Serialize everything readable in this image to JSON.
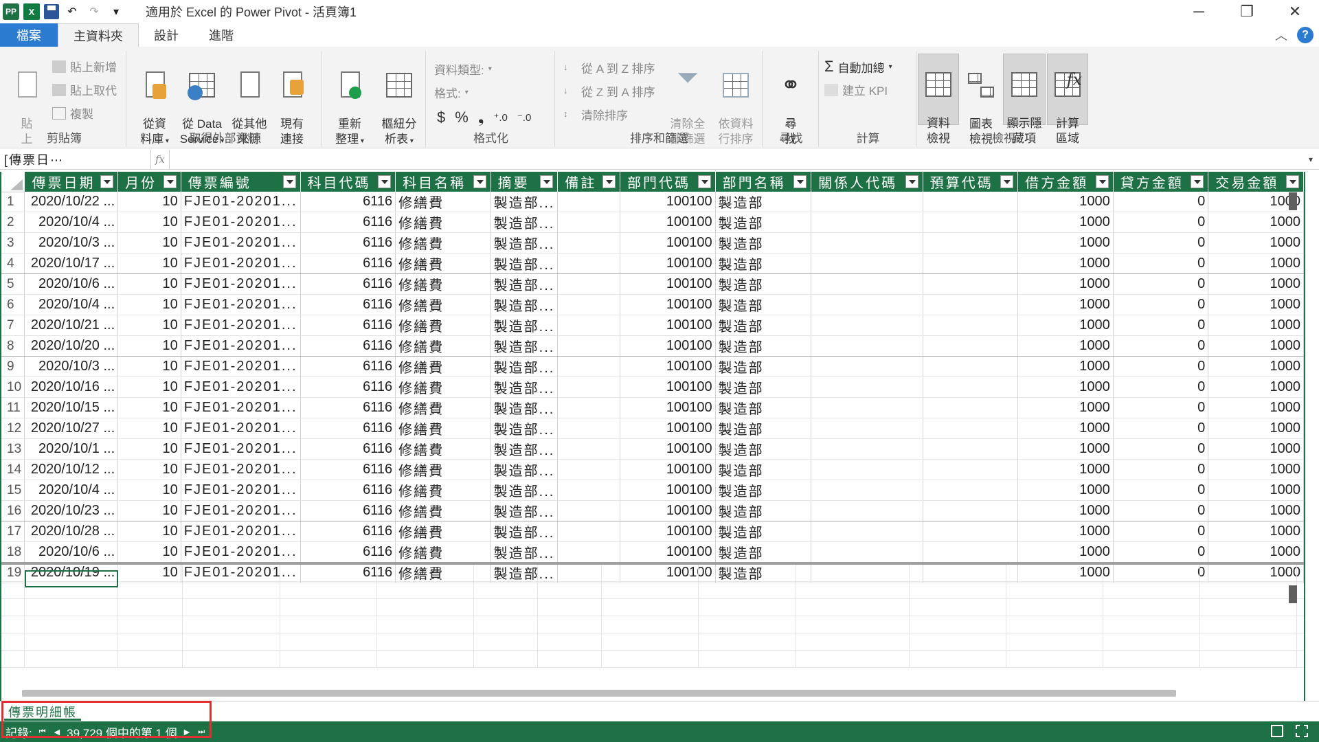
{
  "window": {
    "title": "適用於 Excel 的 Power Pivot - 活頁簿1",
    "minimize": "─",
    "restore": "❐",
    "close": "✕"
  },
  "qat": {
    "undo": "↶",
    "redo": "↷",
    "customize": "▾"
  },
  "tabs": [
    "檔案",
    "主資料夾",
    "設計",
    "進階"
  ],
  "ribbon": {
    "clipboard": {
      "label": "剪貼簿",
      "paste": "貼\n上",
      "paste_append": "貼上新增",
      "paste_replace": "貼上取代",
      "copy": "複製"
    },
    "external": {
      "label": "取得外部資料",
      "from_db": "從資\n料庫",
      "from_service": "從 Data\nService",
      "from_other": "從其他\n來源",
      "existing": "現有\n連接"
    },
    "refresh": "重新\n整理",
    "pivot": "樞紐分\n析表",
    "format": {
      "label": "格式化",
      "data_type": "資料類型:",
      "format": "格式:",
      "currency": "$",
      "percent": "%",
      "comma": "❟",
      "inc": "⁺.0",
      "dec": "⁻.0"
    },
    "sort": {
      "label": "排序和篩選",
      "a_to_z": "從 A 到 Z 排序",
      "z_to_a": "從 Z 到 A 排序",
      "clear_sort": "清除排序",
      "clear_filter": "清除全\n部篩選",
      "sort_by": "依資料\n行排序"
    },
    "find": {
      "label": "尋找",
      "btn": "尋\n找"
    },
    "calc": {
      "label": "計算",
      "autosum": "自動加總",
      "kpi": "建立 KPI"
    },
    "view": {
      "label": "檢視",
      "data_view": "資料\n檢視",
      "diagram_view": "圖表\n檢視",
      "show_hidden": "顯示隱\n藏項",
      "calc_area": "計算\n區域"
    }
  },
  "formula_bar": {
    "name_box": "[傳票日⋯",
    "fx": "fx"
  },
  "columns": [
    "傳票日期",
    "月份",
    "傳票編號",
    "科目代碼",
    "科目名稱",
    "摘要",
    "備註",
    "部門代碼",
    "部門名稱",
    "關係人代碼",
    "預算代碼",
    "借方金額",
    "貸方金額",
    "交易金額"
  ],
  "rows": [
    [
      "2020/10/22 ...",
      "10",
      "FJE01-20201...",
      "6116",
      "修繕費",
      "製造部...",
      "",
      "100100",
      "製造部",
      "",
      "",
      "1000",
      "0",
      "1000"
    ],
    [
      "2020/10/4 ...",
      "10",
      "FJE01-20201...",
      "6116",
      "修繕費",
      "製造部...",
      "",
      "100100",
      "製造部",
      "",
      "",
      "1000",
      "0",
      "1000"
    ],
    [
      "2020/10/3 ...",
      "10",
      "FJE01-20201...",
      "6116",
      "修繕費",
      "製造部...",
      "",
      "100100",
      "製造部",
      "",
      "",
      "1000",
      "0",
      "1000"
    ],
    [
      "2020/10/17 ...",
      "10",
      "FJE01-20201...",
      "6116",
      "修繕費",
      "製造部...",
      "",
      "100100",
      "製造部",
      "",
      "",
      "1000",
      "0",
      "1000"
    ],
    [
      "2020/10/6 ...",
      "10",
      "FJE01-20201...",
      "6116",
      "修繕費",
      "製造部...",
      "",
      "100100",
      "製造部",
      "",
      "",
      "1000",
      "0",
      "1000"
    ],
    [
      "2020/10/4 ...",
      "10",
      "FJE01-20201...",
      "6116",
      "修繕費",
      "製造部...",
      "",
      "100100",
      "製造部",
      "",
      "",
      "1000",
      "0",
      "1000"
    ],
    [
      "2020/10/21 ...",
      "10",
      "FJE01-20201...",
      "6116",
      "修繕費",
      "製造部...",
      "",
      "100100",
      "製造部",
      "",
      "",
      "1000",
      "0",
      "1000"
    ],
    [
      "2020/10/20 ...",
      "10",
      "FJE01-20201...",
      "6116",
      "修繕費",
      "製造部...",
      "",
      "100100",
      "製造部",
      "",
      "",
      "1000",
      "0",
      "1000"
    ],
    [
      "2020/10/3 ...",
      "10",
      "FJE01-20201...",
      "6116",
      "修繕費",
      "製造部...",
      "",
      "100100",
      "製造部",
      "",
      "",
      "1000",
      "0",
      "1000"
    ],
    [
      "2020/10/16 ...",
      "10",
      "FJE01-20201...",
      "6116",
      "修繕費",
      "製造部...",
      "",
      "100100",
      "製造部",
      "",
      "",
      "1000",
      "0",
      "1000"
    ],
    [
      "2020/10/15 ...",
      "10",
      "FJE01-20201...",
      "6116",
      "修繕費",
      "製造部...",
      "",
      "100100",
      "製造部",
      "",
      "",
      "1000",
      "0",
      "1000"
    ],
    [
      "2020/10/27 ...",
      "10",
      "FJE01-20201...",
      "6116",
      "修繕費",
      "製造部...",
      "",
      "100100",
      "製造部",
      "",
      "",
      "1000",
      "0",
      "1000"
    ],
    [
      "2020/10/1 ...",
      "10",
      "FJE01-20201...",
      "6116",
      "修繕費",
      "製造部...",
      "",
      "100100",
      "製造部",
      "",
      "",
      "1000",
      "0",
      "1000"
    ],
    [
      "2020/10/12 ...",
      "10",
      "FJE01-20201...",
      "6116",
      "修繕費",
      "製造部...",
      "",
      "100100",
      "製造部",
      "",
      "",
      "1000",
      "0",
      "1000"
    ],
    [
      "2020/10/4 ...",
      "10",
      "FJE01-20201...",
      "6116",
      "修繕費",
      "製造部...",
      "",
      "100100",
      "製造部",
      "",
      "",
      "1000",
      "0",
      "1000"
    ],
    [
      "2020/10/23 ...",
      "10",
      "FJE01-20201...",
      "6116",
      "修繕費",
      "製造部...",
      "",
      "100100",
      "製造部",
      "",
      "",
      "1000",
      "0",
      "1000"
    ],
    [
      "2020/10/28 ...",
      "10",
      "FJE01-20201...",
      "6116",
      "修繕費",
      "製造部...",
      "",
      "100100",
      "製造部",
      "",
      "",
      "1000",
      "0",
      "1000"
    ],
    [
      "2020/10/6 ...",
      "10",
      "FJE01-20201...",
      "6116",
      "修繕費",
      "製造部...",
      "",
      "100100",
      "製造部",
      "",
      "",
      "1000",
      "0",
      "1000"
    ],
    [
      "2020/10/19 ...",
      "10",
      "FJE01-20201...",
      "6116",
      "修繕費",
      "製造部...",
      "",
      "100100",
      "製造部",
      "",
      "",
      "1000",
      "0",
      "1000"
    ]
  ],
  "sheet_tab": "傳票明細帳",
  "status": {
    "records_label": "記錄:",
    "record_text": "39,729 個中的第 1 個"
  },
  "colors": {
    "accent": "#1e7145",
    "file_tab": "#2b7bd1",
    "highlight": "#e03131"
  }
}
